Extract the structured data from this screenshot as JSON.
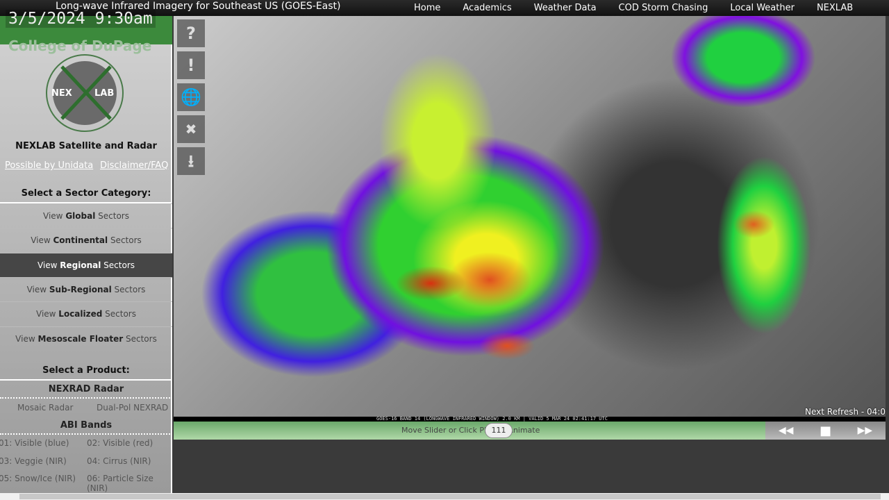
{
  "header": {
    "title": "Long-wave Infrared Imagery for Southeast US (GOES-East)",
    "nav": [
      "Home",
      "Academics",
      "Weather Data",
      "COD Storm Chasing",
      "Local Weather",
      "NEXLAB"
    ]
  },
  "sidebar": {
    "clock": "3/5/2024 9:30am",
    "college": "College of DuPage",
    "logo_text": [
      "NEX",
      "LAB"
    ],
    "site_name": "NEXLAB Satellite and Radar",
    "links": [
      "Possible by Unidata",
      "Disclaimer/FAQ"
    ],
    "sector_heading": "Select a Sector Category:",
    "sectors": [
      {
        "pre": "View ",
        "bold": "Global",
        "post": " Sectors"
      },
      {
        "pre": "View ",
        "bold": "Continental",
        "post": " Sectors"
      },
      {
        "pre": "View ",
        "bold": "Regional",
        "post": " Sectors",
        "selected": true
      },
      {
        "pre": "View ",
        "bold": "Sub-Regional",
        "post": " Sectors"
      },
      {
        "pre": "View ",
        "bold": "Localized",
        "post": " Sectors"
      },
      {
        "pre": "View ",
        "bold": "Mesoscale Floater",
        "post": " Sectors"
      }
    ],
    "product_heading": "Select a Product:",
    "radar_heading": "NEXRAD Radar",
    "radar": [
      "Mosaic Radar",
      "Dual-Pol NEXRAD"
    ],
    "abi_heading": "ABI Bands",
    "bands": [
      "01: Visible (blue)",
      "02: Visible (red)",
      "03: Veggie (NIR)",
      "04: Cirrus (NIR)",
      "05: Snow/Ice (NIR)",
      "06: Particle Size (NIR)"
    ]
  },
  "map": {
    "caption": "GOES-16 BAND 14 (LONGWAVE INFRARED WINDOW) 2.0 KM | VALID 5 MAR 24 02:41:17 UTC",
    "next_refresh": "Next Refresh - 04:0",
    "tools": [
      "?",
      "!",
      "globe",
      "satellite",
      "download"
    ]
  },
  "animation": {
    "slider_label": "Move Slider or Click Play to Animate",
    "frame": "111",
    "controls": [
      "◀◀",
      "■",
      "▶▶"
    ]
  }
}
